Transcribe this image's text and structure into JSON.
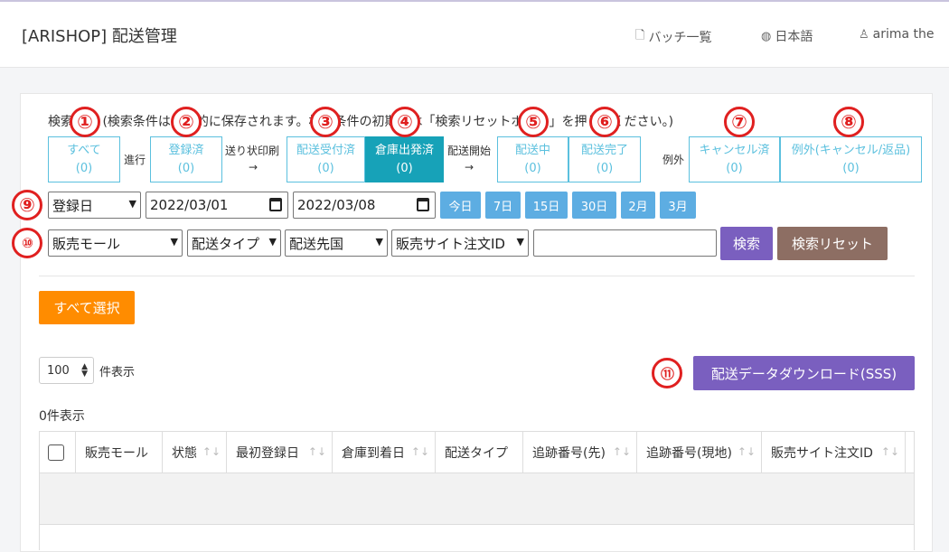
{
  "header": {
    "title": "[ARISHOP] 配送管理",
    "nav": [
      {
        "label": "バッチ一覧",
        "icon": "document-icon"
      },
      {
        "label": "日本語",
        "icon": "globe-icon"
      },
      {
        "label": "arima the",
        "icon": "user-icon"
      }
    ]
  },
  "note": "検索条件 (検索条件は自動的に保存されます。検索条件の初期化は「検索リセットボタン」を押してください。)",
  "statuses": [
    {
      "label": "すべて",
      "count": "(0)"
    },
    {
      "label": "登録済",
      "count": "(0)"
    },
    {
      "label": "配送受付済",
      "count": "(0)"
    },
    {
      "label": "倉庫出発済",
      "count": "(0)"
    },
    {
      "label": "配送中",
      "count": "(0)"
    },
    {
      "label": "配送完了",
      "count": "(0)"
    },
    {
      "label": "キャンセル済",
      "count": "(0)"
    },
    {
      "label": "例外(キャンセル/返品)",
      "count": "(0)"
    }
  ],
  "connectors": {
    "progress": "進行",
    "invoice_print": "送り状印刷",
    "delivery_start": "配送開始",
    "exception": "例外",
    "arrow": "→"
  },
  "annotations": [
    "①",
    "②",
    "③",
    "④",
    "⑤",
    "⑥",
    "⑦",
    "⑧",
    "⑨",
    "⑩",
    "⑪"
  ],
  "date_filter": {
    "field": "登録日",
    "from": "2022/03/01",
    "to": "2022/03/08",
    "quick": [
      "今日",
      "7日",
      "15日",
      "30日",
      "2月",
      "3月"
    ]
  },
  "filters": {
    "mall": "販売モール",
    "delivery_type": "配送タイプ",
    "destination": "配送先国",
    "order_id_field": "販売サイト注文ID",
    "search_value": "",
    "search_button": "検索",
    "reset_button": "検索リセット"
  },
  "select_all": "すべて選択",
  "page_size": {
    "value": "100",
    "suffix": "件表示"
  },
  "download_button": "配送データダウンロード(SSS)",
  "result_count": "0件表示",
  "table": {
    "columns": [
      "販売モール",
      "状態",
      "最初登録日",
      "倉庫到着日",
      "配送タイプ",
      "追跡番号(先)",
      "追跡番号(現地)",
      "販売サイト注文ID"
    ]
  },
  "colors": {
    "status_outline": "#5bc0de",
    "status_active": "#17a2b8",
    "quick_button": "#5dade2",
    "search_button": "#7a5fbf",
    "reset_button": "#8d6e63",
    "select_all": "#ff8c00",
    "download": "#7a5fbf",
    "annotation": "#e02020"
  }
}
